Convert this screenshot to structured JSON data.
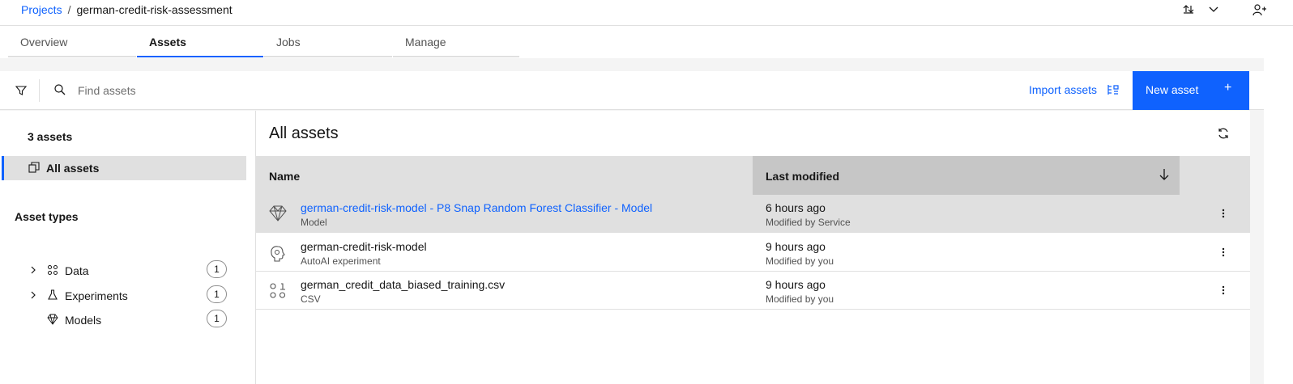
{
  "breadcrumb": {
    "projects": "Projects",
    "separator": "/",
    "current": "german-credit-risk-assessment"
  },
  "tabs": [
    {
      "label": "Overview"
    },
    {
      "label": "Assets"
    },
    {
      "label": "Jobs"
    },
    {
      "label": "Manage"
    }
  ],
  "toolbar": {
    "search_placeholder": "Find assets",
    "import_label": "Import assets",
    "new_asset_label": "New asset",
    "new_asset_plus": "+"
  },
  "sidebar": {
    "count": "3 assets",
    "all_assets": "All assets",
    "types_title": "Asset types",
    "types": [
      {
        "chevron": "›",
        "label": "Data",
        "count": "1",
        "icon": "data-icon"
      },
      {
        "chevron": "›",
        "label": "Experiments",
        "count": "1",
        "icon": "flask-icon"
      },
      {
        "chevron": "",
        "label": "Models",
        "count": "1",
        "icon": "diamond-icon"
      }
    ]
  },
  "main": {
    "title": "All assets",
    "columns": {
      "name": "Name",
      "modified": "Last modified"
    },
    "rows": [
      {
        "name": "german-credit-risk-model - P8 Snap Random Forest Classifier - Model",
        "type": "Model",
        "modified": "6 hours ago",
        "modified_by": "Modified by Service",
        "icon": "diamond-icon"
      },
      {
        "name": "german-credit-risk-model",
        "type": "AutoAI experiment",
        "modified": "9 hours ago",
        "modified_by": "Modified by you",
        "icon": "brain-icon"
      },
      {
        "name": "german_credit_data_biased_training.csv",
        "type": "CSV",
        "modified": "9 hours ago",
        "modified_by": "Modified by you",
        "icon": "data-icon"
      }
    ]
  },
  "colors": {
    "accent": "#0f62fe",
    "header_bg": "#e0e0e0",
    "sorted_col_bg": "#c6c6c6"
  }
}
